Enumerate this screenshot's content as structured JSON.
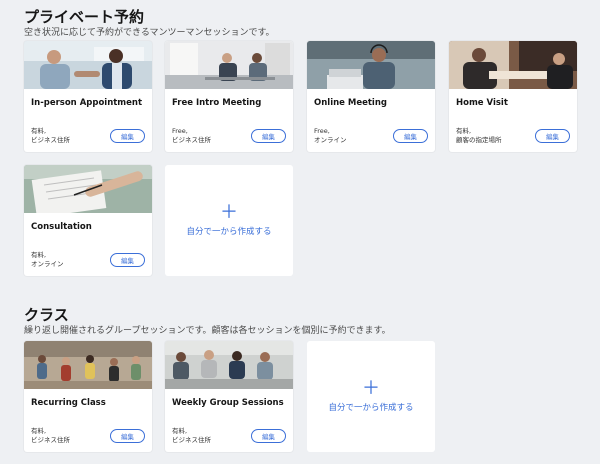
{
  "private": {
    "title": "プライベート予約",
    "subtitle": "空き状況に応じて予約ができるマンツーマンセッションです。",
    "cards": [
      {
        "title": "In-person Appointment",
        "meta1": "有料,",
        "meta2": "ビジネス住所",
        "edit": "編集",
        "image": "two-men-handshake-office"
      },
      {
        "title": "Free Intro Meeting",
        "meta1": "Free,",
        "meta2": "ビジネス住所",
        "edit": "編集",
        "image": "meeting-at-desk"
      },
      {
        "title": "Online Meeting",
        "meta1": "Free,",
        "meta2": "オンライン",
        "edit": "編集",
        "image": "man-with-headset-laptop"
      },
      {
        "title": "Home Visit",
        "meta1": "有料,",
        "meta2": "顧客の指定場所",
        "edit": "編集",
        "image": "consultation-at-home"
      },
      {
        "title": "Consultation",
        "meta1": "有料,",
        "meta2": "オンライン",
        "edit": "編集",
        "image": "writing-on-clipboard"
      }
    ],
    "create_label": "自分で一から作成する"
  },
  "classes": {
    "title": "クラス",
    "subtitle": "繰り返し開催されるグループセッションです。顧客は各セッションを個別に予約できます。",
    "cards": [
      {
        "title": "Recurring Class",
        "meta1": "有料,",
        "meta2": "ビジネス住所",
        "edit": "編集",
        "image": "group-class-room"
      },
      {
        "title": "Weekly Group Sessions",
        "meta1": "有料,",
        "meta2": "ビジネス住所",
        "edit": "編集",
        "image": "group-sitting-circle"
      }
    ],
    "create_label": "自分で一から作成する"
  },
  "colors": {
    "accent": "#3b6fd8",
    "background": "#eef0f3",
    "card": "#ffffff"
  }
}
